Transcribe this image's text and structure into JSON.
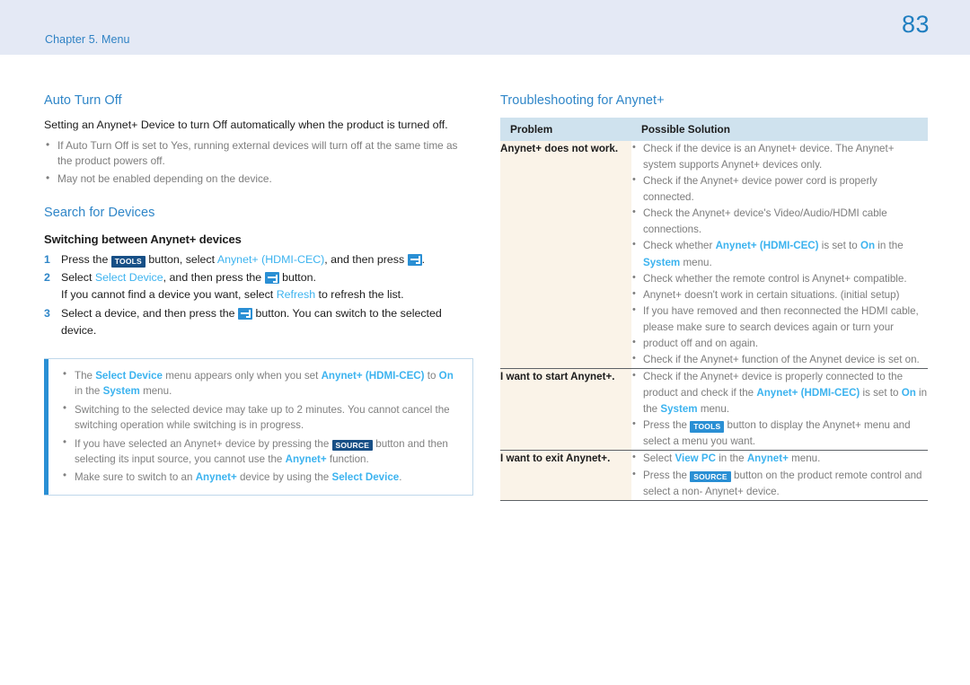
{
  "header": {
    "chapter": "Chapter 5. Menu",
    "page_number": "83",
    "band_color": "#e4e9f5",
    "accent_color": "#2f86c8"
  },
  "left": {
    "section1": {
      "title": "Auto Turn Off",
      "intro": "Setting an Anynet+ Device to turn Off automatically when the product is turned off.",
      "bullets": [
        "If Auto Turn Off is set to Yes, running external devices will turn off at the same time as the product powers off.",
        "May not be enabled depending on the device."
      ]
    },
    "section2": {
      "title": "Search for Devices",
      "subtitle": "Switching between Anynet+ devices",
      "steps": [
        {
          "num": "1",
          "parts": [
            {
              "t": "text",
              "v": "Press the "
            },
            {
              "t": "key",
              "v": "TOOLS",
              "style": "dark"
            },
            {
              "t": "text",
              "v": " button, select "
            },
            {
              "t": "blue",
              "v": "Anynet+ (HDMI-CEC)"
            },
            {
              "t": "text",
              "v": ", and then press "
            },
            {
              "t": "enter"
            },
            {
              "t": "text",
              "v": "."
            }
          ]
        },
        {
          "num": "2",
          "parts": [
            {
              "t": "text",
              "v": "Select "
            },
            {
              "t": "blue",
              "v": "Select Device"
            },
            {
              "t": "text",
              "v": ", and then press the "
            },
            {
              "t": "enter"
            },
            {
              "t": "text",
              "v": " button."
            }
          ],
          "sub_parts": [
            {
              "t": "text",
              "v": "If you cannot find a device you want, select "
            },
            {
              "t": "blue",
              "v": "Refresh"
            },
            {
              "t": "text",
              "v": " to refresh the list."
            }
          ]
        },
        {
          "num": "3",
          "parts": [
            {
              "t": "text",
              "v": "Select a device, and then press the "
            },
            {
              "t": "enter"
            },
            {
              "t": "text",
              "v": " button. You can switch to the selected device."
            }
          ]
        }
      ]
    },
    "note_box": {
      "items": [
        [
          {
            "t": "text",
            "v": "The "
          },
          {
            "t": "blueb",
            "v": "Select Device"
          },
          {
            "t": "text",
            "v": " menu appears only when you set "
          },
          {
            "t": "blueb",
            "v": "Anynet+ (HDMI-CEC)"
          },
          {
            "t": "text",
            "v": " to "
          },
          {
            "t": "blueb",
            "v": "On"
          },
          {
            "t": "text",
            "v": " in the "
          },
          {
            "t": "blueb",
            "v": "System"
          },
          {
            "t": "text",
            "v": " menu."
          }
        ],
        [
          {
            "t": "text",
            "v": "Switching to the selected device may take up to 2 minutes. You cannot cancel the switching operation while switching is in progress."
          }
        ],
        [
          {
            "t": "text",
            "v": "If you have selected an Anynet+ device by pressing the "
          },
          {
            "t": "key",
            "v": "SOURCE",
            "style": "dark"
          },
          {
            "t": "text",
            "v": " button and then selecting its input source, you cannot use the "
          },
          {
            "t": "blueb",
            "v": "Anynet+"
          },
          {
            "t": "text",
            "v": " function."
          }
        ],
        [
          {
            "t": "text",
            "v": "Make sure to switch to an "
          },
          {
            "t": "blueb",
            "v": "Anynet+"
          },
          {
            "t": "text",
            "v": " device by using the "
          },
          {
            "t": "blueb",
            "v": "Select Device"
          },
          {
            "t": "text",
            "v": "."
          }
        ]
      ]
    }
  },
  "right": {
    "title": "Troubleshooting for Anynet+",
    "table": {
      "header_bg": "#cfe2ee",
      "problem_bg": "#faf3e8",
      "columns": [
        "Problem",
        "Possible Solution"
      ],
      "rows": [
        {
          "problem": "Anynet+ does not work.",
          "solutions": [
            {
              "bullet": true,
              "parts": [
                {
                  "t": "text",
                  "v": "Check if the device is an Anynet+ device. The Anynet+ system supports Anynet+ devices only."
                }
              ]
            },
            {
              "bullet": true,
              "parts": [
                {
                  "t": "text",
                  "v": "Check if the Anynet+ device power cord is properly connected."
                }
              ]
            },
            {
              "bullet": true,
              "parts": [
                {
                  "t": "text",
                  "v": "Check the Anynet+ device's Video/Audio/HDMI cable connections."
                }
              ]
            },
            {
              "bullet": true,
              "parts": [
                {
                  "t": "text",
                  "v": "Check whether "
                },
                {
                  "t": "blueb",
                  "v": "Anynet+ (HDMI-CEC)"
                },
                {
                  "t": "text",
                  "v": " is set to "
                },
                {
                  "t": "blueb",
                  "v": "On"
                },
                {
                  "t": "text",
                  "v": " in the "
                },
                {
                  "t": "blueb",
                  "v": "System"
                },
                {
                  "t": "text",
                  "v": " menu."
                }
              ]
            },
            {
              "bullet": true,
              "parts": [
                {
                  "t": "text",
                  "v": "Check whether the remote control is Anynet+ compatible."
                }
              ]
            },
            {
              "bullet": true,
              "parts": [
                {
                  "t": "text",
                  "v": "Anynet+ doesn't work in certain situations. (initial setup)"
                }
              ]
            },
            {
              "bullet": true,
              "parts": [
                {
                  "t": "text",
                  "v": "If you have removed and then reconnected the HDMI cable, please make sure to search devices again or turn your"
                }
              ]
            },
            {
              "bullet": true,
              "parts": [
                {
                  "t": "text",
                  "v": "product off and on again."
                }
              ]
            },
            {
              "bullet": true,
              "parts": [
                {
                  "t": "text",
                  "v": "Check if the Anynet+ function of the Anynet device is set on."
                }
              ]
            }
          ]
        },
        {
          "problem": "I want to start Anynet+.",
          "solutions": [
            {
              "bullet": true,
              "parts": [
                {
                  "t": "text",
                  "v": "Check if the Anynet+ device is properly connected to the product and check if the "
                },
                {
                  "t": "blueb",
                  "v": "Anynet+ (HDMI-CEC)"
                },
                {
                  "t": "text",
                  "v": " is set to "
                },
                {
                  "t": "blueb",
                  "v": "On"
                },
                {
                  "t": "text",
                  "v": " in the "
                },
                {
                  "t": "blueb",
                  "v": "System"
                },
                {
                  "t": "text",
                  "v": " menu."
                }
              ]
            },
            {
              "bullet": true,
              "parts": [
                {
                  "t": "text",
                  "v": "Press the "
                },
                {
                  "t": "key",
                  "v": "TOOLS",
                  "style": "light"
                },
                {
                  "t": "text",
                  "v": " button to display the Anynet+ menu and select a menu you want."
                }
              ]
            }
          ]
        },
        {
          "problem": "I want to exit Anynet+.",
          "solutions": [
            {
              "bullet": true,
              "parts": [
                {
                  "t": "text",
                  "v": "Select "
                },
                {
                  "t": "blueb",
                  "v": "View PC"
                },
                {
                  "t": "text",
                  "v": " in the "
                },
                {
                  "t": "blueb",
                  "v": "Anynet+"
                },
                {
                  "t": "text",
                  "v": " menu."
                }
              ]
            },
            {
              "bullet": true,
              "parts": [
                {
                  "t": "text",
                  "v": "Press the "
                },
                {
                  "t": "key",
                  "v": "SOURCE",
                  "style": "light"
                },
                {
                  "t": "text",
                  "v": " button on the product remote control and select a non- Anynet+ device."
                }
              ]
            }
          ]
        }
      ]
    }
  }
}
